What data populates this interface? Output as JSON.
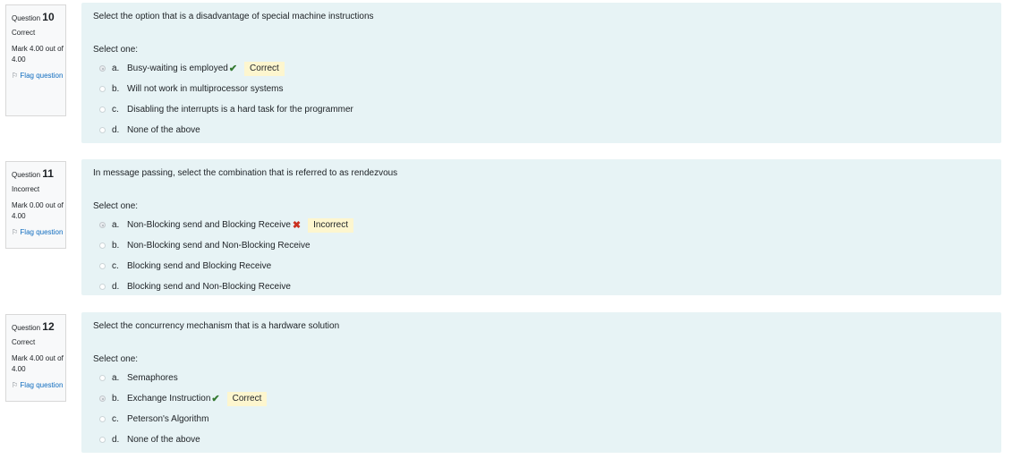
{
  "questions": [
    {
      "number_prefix": "Question",
      "number": "10",
      "state": "Correct",
      "grade": "Mark 4.00 out of 4.00",
      "flag": "Flag question",
      "text": "Select the option that is a disadvantage of special machine instructions",
      "prompt": "Select one:",
      "answers": [
        {
          "letter": "a.",
          "label": "Busy-waiting is employed",
          "checked": true,
          "mark": "correct",
          "feedback": "Correct"
        },
        {
          "letter": "b.",
          "label": "Will not work in multiprocessor systems",
          "checked": false
        },
        {
          "letter": "c.",
          "label": "Disabling the interrupts is a hard task for the programmer",
          "checked": false
        },
        {
          "letter": "d.",
          "label": "None of the above",
          "checked": false
        }
      ]
    },
    {
      "number_prefix": "Question",
      "number": "11",
      "state": "Incorrect",
      "grade": "Mark 0.00 out of 4.00",
      "flag": "Flag question",
      "text": "In message passing, select the combination that is referred to as rendezvous",
      "prompt": "Select one:",
      "answers": [
        {
          "letter": "a.",
          "label": "Non-Blocking send and Blocking Receive",
          "checked": true,
          "mark": "incorrect",
          "feedback": "Incorrect"
        },
        {
          "letter": "b.",
          "label": "Non-Blocking send and Non-Blocking Receive",
          "checked": false
        },
        {
          "letter": "c.",
          "label": "Blocking send and Blocking Receive",
          "checked": false
        },
        {
          "letter": "d.",
          "label": "Blocking send and Non-Blocking Receive",
          "checked": false
        }
      ]
    },
    {
      "number_prefix": "Question",
      "number": "12",
      "state": "Correct",
      "grade": "Mark 4.00 out of 4.00",
      "flag": "Flag question",
      "text": "Select the concurrency mechanism that is a hardware solution",
      "prompt": "Select one:",
      "answers": [
        {
          "letter": "a.",
          "label": "Semaphores",
          "checked": false
        },
        {
          "letter": "b.",
          "label": "Exchange Instruction",
          "checked": true,
          "mark": "correct",
          "feedback": "Correct"
        },
        {
          "letter": "c.",
          "label": "Peterson's Algorithm",
          "checked": false
        },
        {
          "letter": "d.",
          "label": "None of the above",
          "checked": false
        }
      ]
    }
  ],
  "icons": {
    "correct": "check-icon",
    "incorrect": "cross-icon",
    "flag": "flag-icon"
  },
  "colors": {
    "content_bg": "#e7f3f5",
    "correct_mark": "#357a32",
    "incorrect_mark": "#ca3120",
    "feedback_bg": "#fdf6cf",
    "link": "#0f6cbf"
  }
}
